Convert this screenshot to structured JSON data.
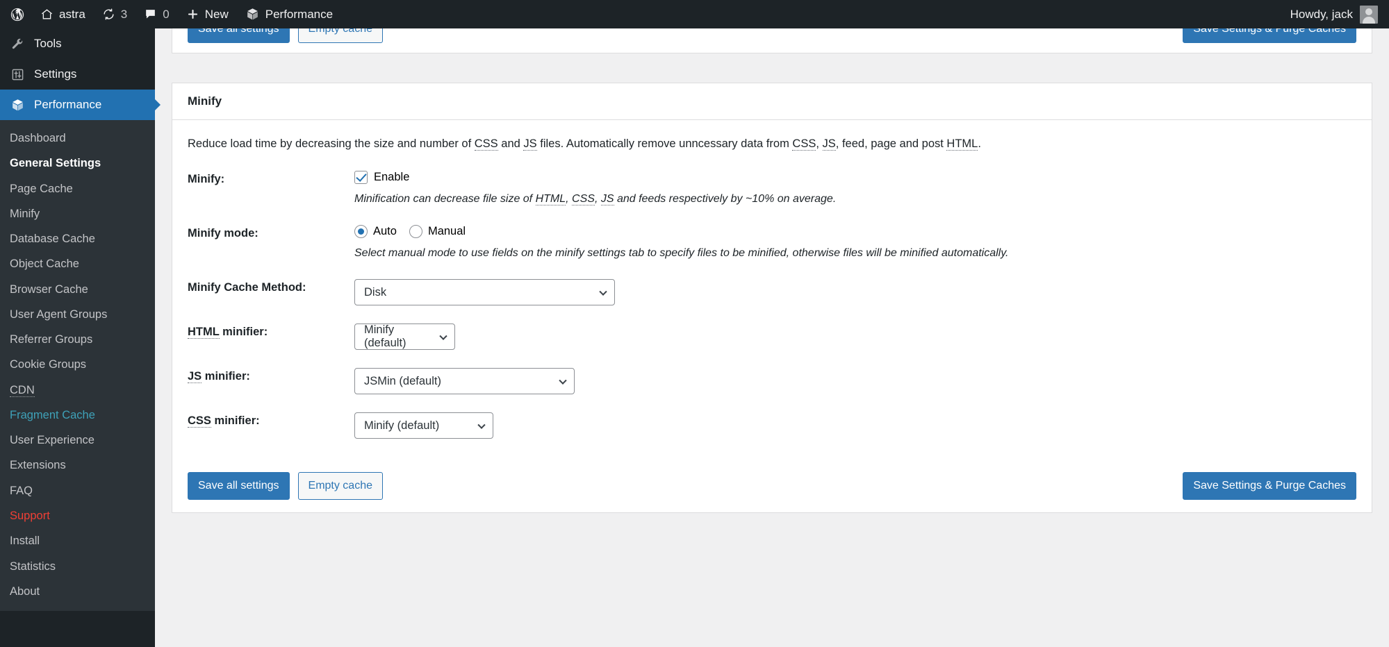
{
  "adminbar": {
    "wp_logo": "wordpress-logo",
    "site_name": "astra",
    "updates_count": "3",
    "comments_count": "0",
    "new_label": "New",
    "performance_label": "Performance",
    "howdy": "Howdy, jack"
  },
  "sidebar": {
    "top_items": [
      {
        "label": "Tools",
        "icon": "wrench-icon",
        "current": false
      },
      {
        "label": "Settings",
        "icon": "settings-sliders-icon",
        "current": false
      },
      {
        "label": "Performance",
        "icon": "cube-icon",
        "current": true
      }
    ],
    "submenu": [
      {
        "label": "Dashboard",
        "state": "normal"
      },
      {
        "label": "General Settings",
        "state": "current"
      },
      {
        "label": "Page Cache",
        "state": "normal"
      },
      {
        "label": "Minify",
        "state": "normal"
      },
      {
        "label": "Database Cache",
        "state": "normal"
      },
      {
        "label": "Object Cache",
        "state": "normal"
      },
      {
        "label": "Browser Cache",
        "state": "normal"
      },
      {
        "label": "User Agent Groups",
        "state": "normal"
      },
      {
        "label": "Referrer Groups",
        "state": "normal"
      },
      {
        "label": "Cookie Groups",
        "state": "normal"
      },
      {
        "label": "CDN",
        "state": "abbr"
      },
      {
        "label": "Fragment Cache",
        "state": "teal"
      },
      {
        "label": "User Experience",
        "state": "normal"
      },
      {
        "label": "Extensions",
        "state": "normal"
      },
      {
        "label": "FAQ",
        "state": "normal"
      },
      {
        "label": "Support",
        "state": "red"
      },
      {
        "label": "Install",
        "state": "normal"
      },
      {
        "label": "Statistics",
        "state": "normal"
      },
      {
        "label": "About",
        "state": "normal"
      }
    ]
  },
  "actions": {
    "save_all": "Save all settings",
    "empty_cache": "Empty cache",
    "save_purge": "Save Settings & Purge Caches"
  },
  "minify": {
    "panel_title": "Minify",
    "description_1": "Reduce load time by decreasing the size and number of ",
    "abbr_css": "CSS",
    "description_2": " and ",
    "abbr_js": "JS",
    "description_3": " files. Automatically remove unncessary data from ",
    "abbr_css2": "CSS",
    "description_4": ", ",
    "abbr_js2": "JS",
    "description_5": ", feed, page and post ",
    "abbr_html": "HTML",
    "description_6": ".",
    "enable_row_label": "Minify:",
    "enable_label": "Enable",
    "enable_checked": true,
    "enable_hint_1": "Minification can decrease file size of ",
    "enable_hint_html": "HTML",
    "enable_hint_2": ", ",
    "enable_hint_css": "CSS",
    "enable_hint_3": ", ",
    "enable_hint_js": "JS",
    "enable_hint_4": " and feeds respectively by ~10% on average.",
    "mode_row_label": "Minify mode:",
    "mode_auto": "Auto",
    "mode_manual": "Manual",
    "mode_selected": "Auto",
    "mode_hint": "Select manual mode to use fields on the minify settings tab to specify files to be minified, otherwise files will be minified automatically.",
    "cache_method_label": "Minify Cache Method:",
    "cache_method_value": "Disk",
    "html_minifier_label_abbr": "HTML",
    "html_minifier_label_rest": " minifier:",
    "html_minifier_value": "Minify (default)",
    "js_minifier_label_abbr": "JS",
    "js_minifier_label_rest": " minifier:",
    "js_minifier_value": "JSMin (default)",
    "css_minifier_label_abbr": "CSS",
    "css_minifier_label_rest": " minifier:",
    "css_minifier_value": "Minify (default)"
  },
  "colors": {
    "admin_dark": "#1d2327",
    "submenu_bg": "#2c3338",
    "accent_blue": "#2271b1",
    "button_blue": "#2e76b4",
    "teal": "#3ea1b8",
    "red": "#f03f35"
  }
}
